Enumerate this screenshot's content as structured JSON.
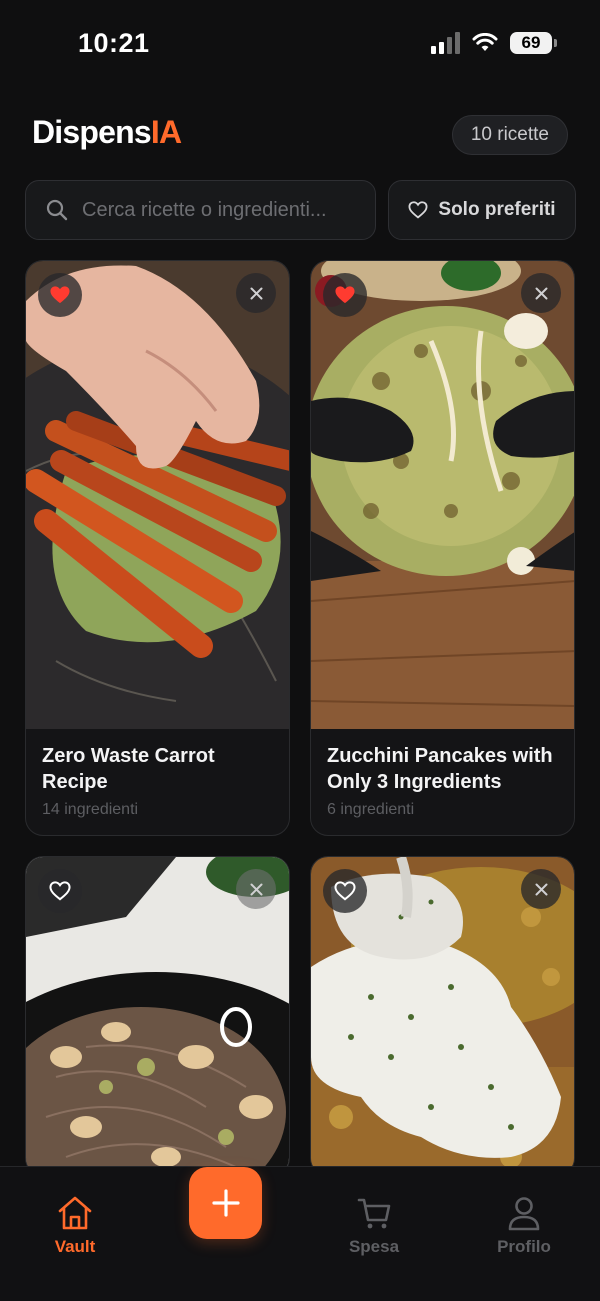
{
  "status_bar": {
    "time": "10:21",
    "battery": "69"
  },
  "header": {
    "logo_main": "Dispens",
    "logo_accent": "IA",
    "count_label": "10 ricette"
  },
  "search": {
    "placeholder": "Cerca ricette o ingredienti...",
    "value": ""
  },
  "filter": {
    "favorites_label": "Solo preferiti"
  },
  "recipes": [
    {
      "title": "Zero Waste Carrot Recipe",
      "ingredients": "14 ingredienti",
      "favorite": true
    },
    {
      "title": "Zucchini Pancakes with Only 3 Ingredients",
      "ingredients": "6 ingredienti",
      "favorite": true
    },
    {
      "title": "",
      "ingredients": "",
      "favorite": false
    },
    {
      "title": "",
      "ingredients": "",
      "favorite": false
    }
  ],
  "tabs": [
    {
      "label": "Vault",
      "icon": "home-icon",
      "active": true
    },
    {
      "label": "Spesa",
      "icon": "cart-icon",
      "active": false
    },
    {
      "label": "Profilo",
      "icon": "user-icon",
      "active": false
    }
  ],
  "colors": {
    "accent": "#ff6a2b",
    "background": "#0f0f10",
    "heart": "#ff3b30"
  }
}
